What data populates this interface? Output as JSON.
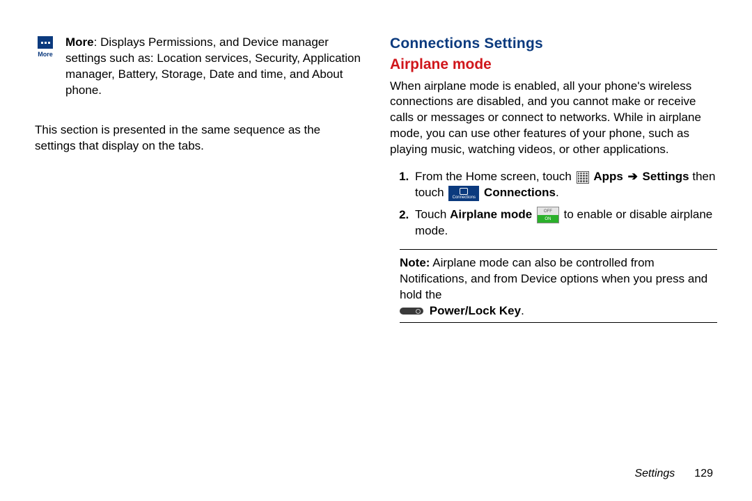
{
  "left": {
    "more_icon_label": "More",
    "more_bold": "More",
    "more_text_rest": ": Displays Permissions, and Device manager settings such as: Location services, Security, Application manager, Battery, Storage, Date and time, and About phone.",
    "sequence_text": "This section is presented in the same sequence as the settings that display on the tabs."
  },
  "right": {
    "heading": "Connections Settings",
    "subheading": "Airplane mode",
    "intro": "When airplane mode is enabled, all your phone's wireless connections are disabled, and you cannot make or receive calls or messages or connect to networks. While in airplane mode, you can use other features of your phone, such as playing music, watching videos, or other applications.",
    "step1_a": "From the Home screen, touch ",
    "step1_apps": "Apps",
    "step1_arrow": "➔",
    "step1_settings": "Settings",
    "step1_b": " then touch ",
    "step1_conn_iconlabel": "Connections",
    "step1_connections": "Connections",
    "step2_a": "Touch ",
    "step2_airplane": "Airplane mode",
    "step2_off": "OFF",
    "step2_on": "ON",
    "step2_b": " to enable or disable airplane mode.",
    "note_label": "Note:",
    "note_text": " Airplane mode can also be controlled from Notifications, and from Device options when you press and hold the ",
    "power_key": "Power/Lock Key",
    "period": "."
  },
  "footer": {
    "section": "Settings",
    "page": "129"
  }
}
